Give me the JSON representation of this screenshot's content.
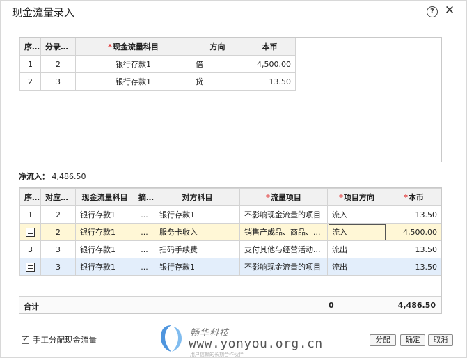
{
  "dialog": {
    "title": "现金流量录入",
    "help_icon": "?",
    "close_icon": "✕"
  },
  "top_table": {
    "headers": [
      "序号",
      "分录序号",
      "现金流量科目",
      "方向",
      "本币"
    ],
    "required_mark": "*",
    "rows": [
      [
        "1",
        "2",
        "银行存款1",
        "借",
        "4,500.00"
      ],
      [
        "2",
        "3",
        "银行存款1",
        "贷",
        "13.50"
      ]
    ]
  },
  "net_inflow": {
    "label": "净流入：",
    "value": "4,486.50"
  },
  "bottom_table": {
    "headers": [
      "序号",
      "对应序号",
      "现金流量科目",
      "摘要",
      "对方科目",
      "流量项目",
      "项目方向",
      "本币"
    ],
    "required_mark": "*",
    "rows": [
      [
        "1",
        "2",
        "银行存款1",
        "...",
        "银行存款1",
        "不影响现金流量的项目",
        "流入",
        "13.50"
      ],
      [
        "",
        "2",
        "银行存款1",
        "...",
        "服务卡收入",
        "销售产成品、商品、...",
        "流入",
        "4,500.00"
      ],
      [
        "3",
        "3",
        "银行存款1",
        "...",
        "扫码手续费",
        "支付其他与经营活动...",
        "流出",
        "13.50"
      ],
      [
        "",
        "3",
        "银行存款1",
        "...",
        "银行存款1",
        "不影响现金流量的项目",
        "流出",
        "13.50"
      ]
    ],
    "total": {
      "label": "合计",
      "zero": "0",
      "sum": "4,486.50"
    }
  },
  "footer": {
    "manual_allocate_label": "手工分配现金流量",
    "allocate_button": "分配",
    "ok_button": "确定",
    "cancel_button": "取消"
  },
  "watermark": {
    "brand": "畅华科技",
    "url": "www.yonyou.org.cn",
    "sub": "用户信赖的长期合作伙伴",
    "logo_color": "#2f82d8"
  }
}
